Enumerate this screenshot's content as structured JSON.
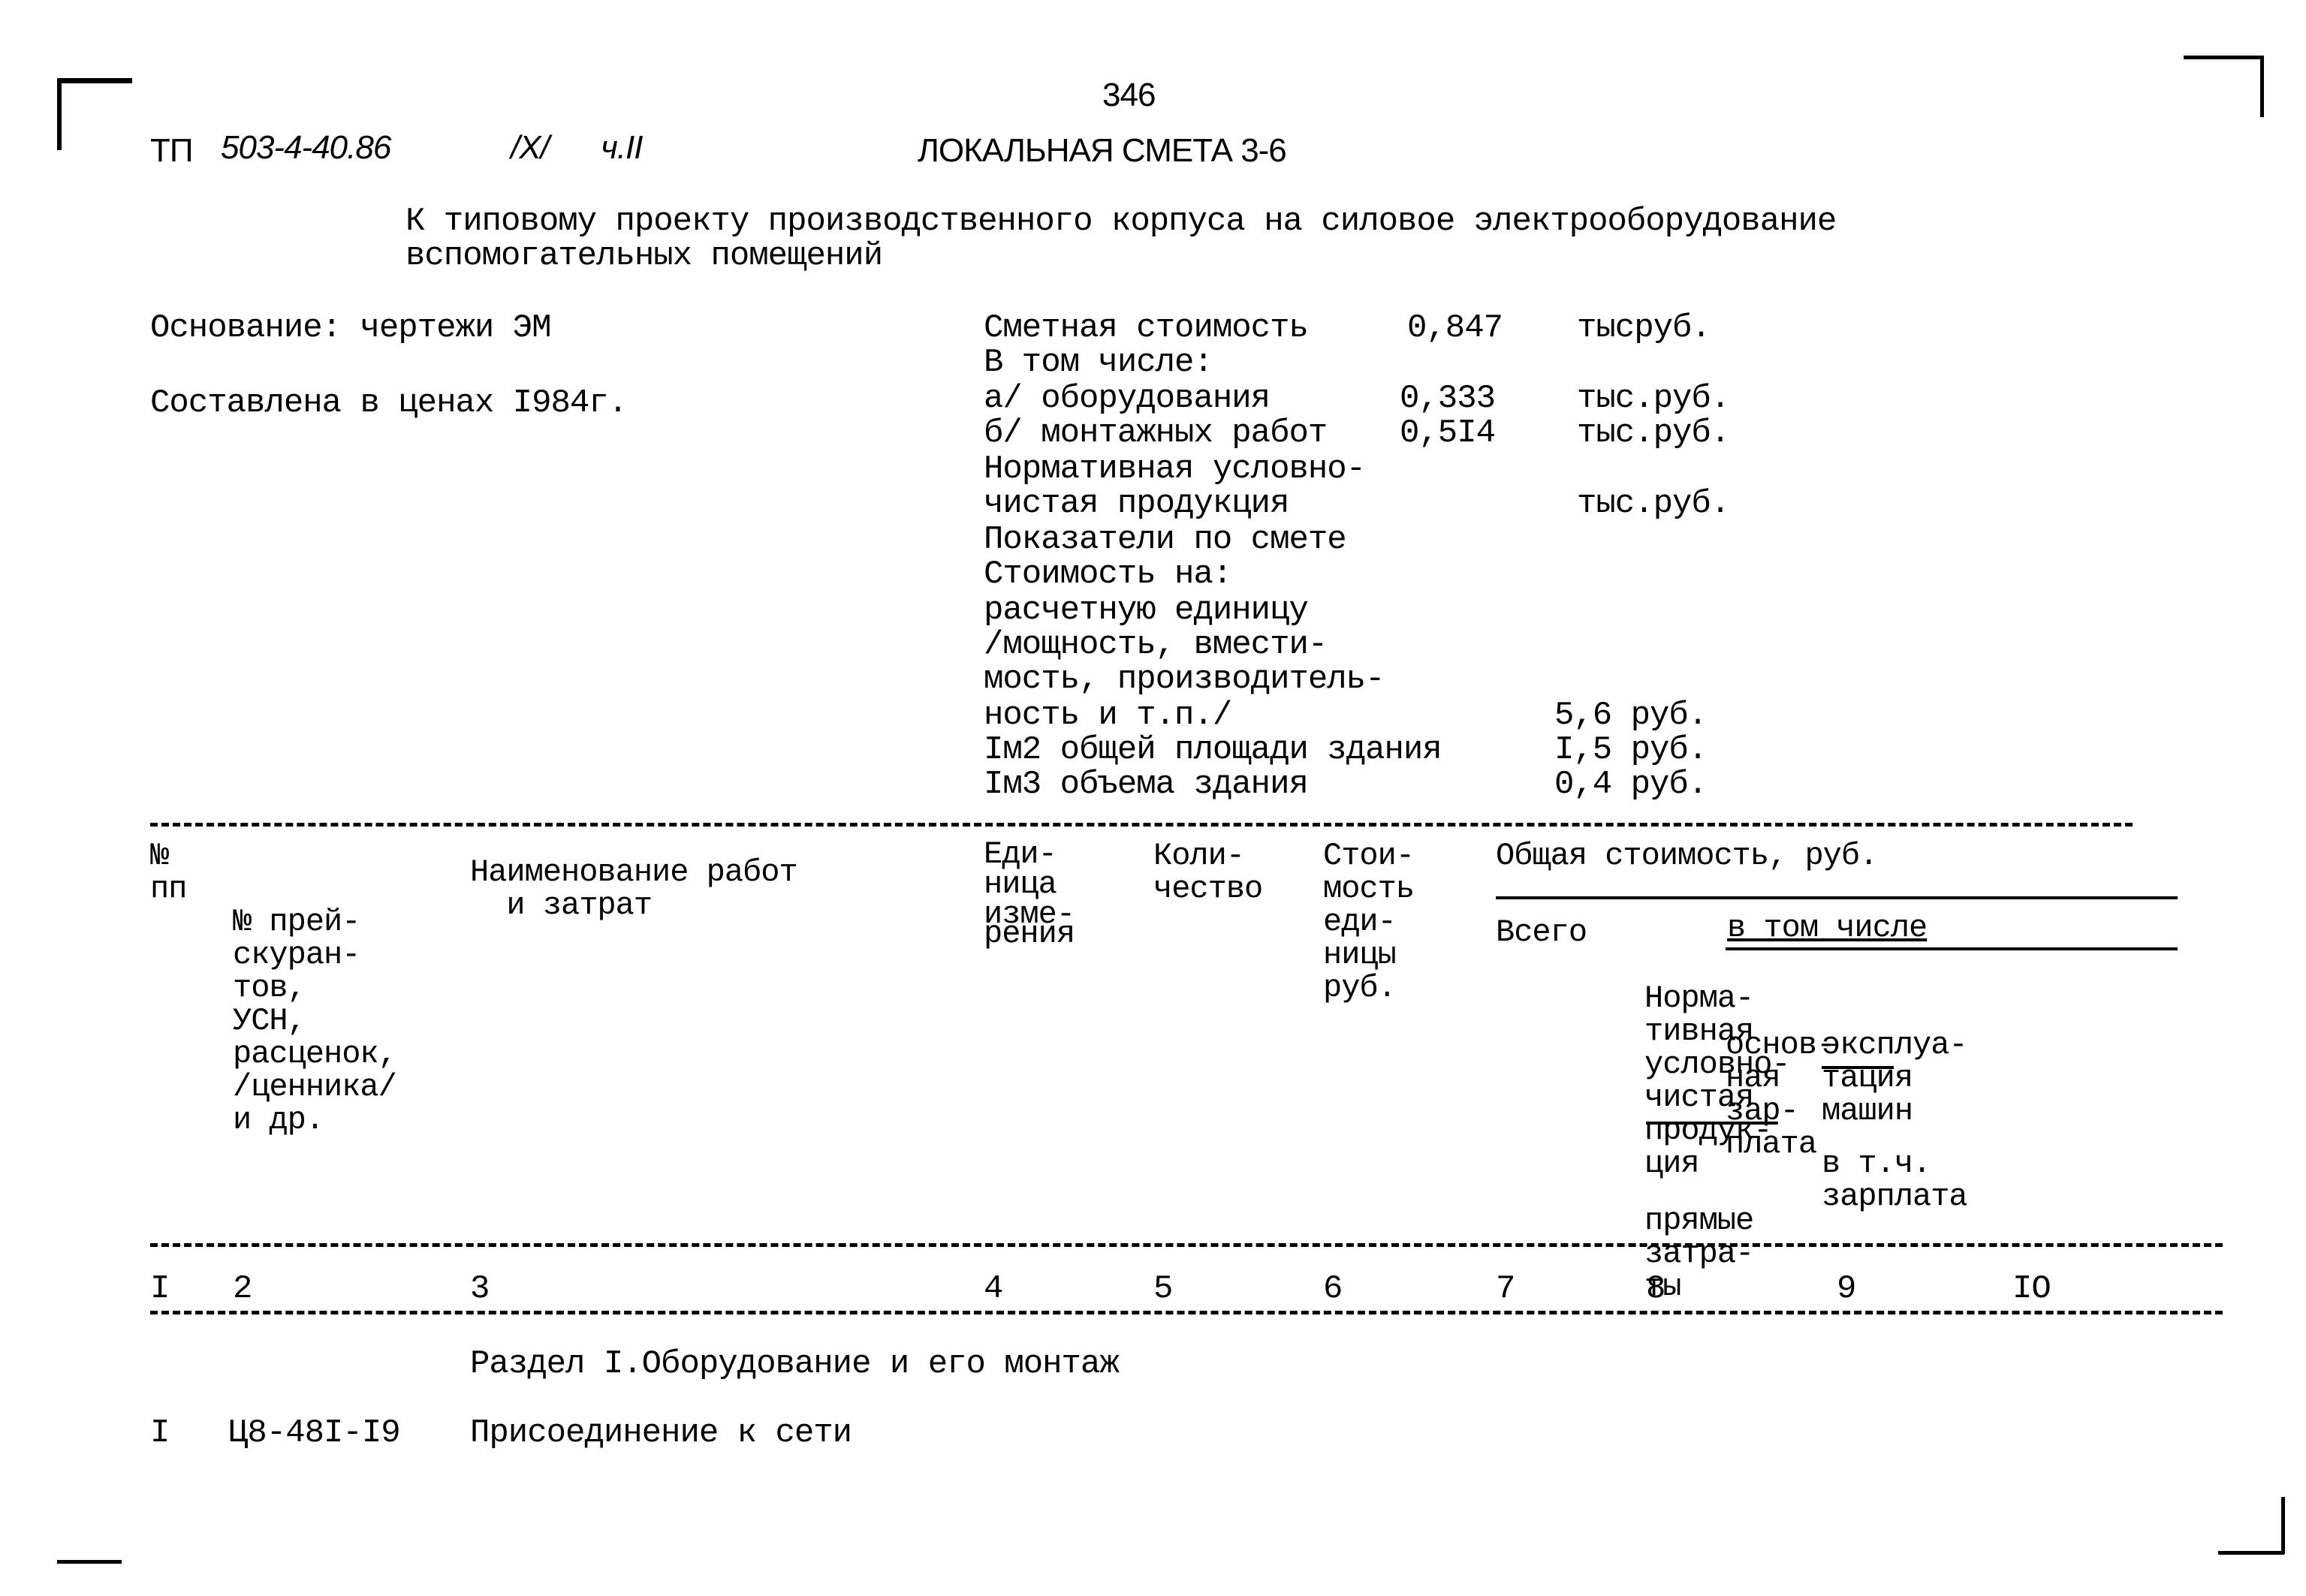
{
  "page_number": "346",
  "doc_code": {
    "prefix": "ТП",
    "code": "503-4-40.86",
    "volume": "/X/",
    "part": "ч.II"
  },
  "title": "ЛОКАЛЬНАЯ СМЕТА 3-6",
  "subtitle": [
    "К типовому проекту производственного корпуса на силовое электрооборудование",
    "вспомогательных помещений"
  ],
  "basis": "Основание: чертежи ЭМ",
  "prices": "Составлена в ценах I984г.",
  "summary": {
    "estimated_cost_label": "Сметная стоимость",
    "estimated_cost_value": "0,847",
    "estimated_cost_unit": "тысруб.",
    "including_label": "В том числе:",
    "equipment_label": "а/ оборудования",
    "equipment_value": "0,333",
    "equipment_unit": "тыс.руб.",
    "installation_label": "б/ монтажных работ",
    "installation_value": "0,5I4",
    "installation_unit": "тыс.руб.",
    "normative_label_1": "Нормативная условно-",
    "normative_label_2": "чистая продукция",
    "normative_unit": "тыс.руб.",
    "indicators_label": "Показатели по смете",
    "cost_per_label": "Стоимость на:",
    "unit_label_1": "расчетную единицу",
    "unit_label_2": "/мощность, вмести-",
    "unit_label_3": "мость, производитель-",
    "unit_label_4": "ность и т.п./",
    "unit_value": "5,6 руб.",
    "area_label": "Iм2 общей площади здания",
    "area_value": "I,5 руб.",
    "volume_label": "Iм3 объема здания",
    "volume_value": "0,4 руб."
  },
  "table": {
    "headers": {
      "col1": [
        "№",
        "пп"
      ],
      "col2": [
        "№ прей-",
        "скуран-",
        "тов,",
        "УСН,",
        "расценок,",
        "/ценника/",
        "и др."
      ],
      "col3": [
        "Наименование работ",
        "  и затрат"
      ],
      "col4": [
        "Еди-",
        "ница",
        "изме-",
        "рения"
      ],
      "col5": [
        "Коли-",
        "чество"
      ],
      "col6": [
        "Стои-",
        "мость",
        "еди-",
        "ницы",
        "руб."
      ],
      "total_group": "Общая стоимость, руб.",
      "col7": "Всего",
      "col8_top": [
        "Норма-",
        "тивная",
        "условно-",
        "чистая",
        "продук-",
        "ция"
      ],
      "col8_bottom": [
        "прямые",
        "затра-",
        "ты"
      ],
      "incl_group": "в том числе",
      "col9": [
        "основ-",
        "ная",
        "зар-",
        "плата"
      ],
      "col10_top": [
        "эксплуа-",
        "тация",
        "машин"
      ],
      "col10_bottom": [
        "в т.ч.",
        "зарплата"
      ]
    },
    "column_numbers": [
      "I",
      "2",
      "3",
      "4",
      "5",
      "6",
      "7",
      "8",
      "9",
      "IO"
    ],
    "section_title": "Раздел I.Оборудование и его монтаж",
    "rows": [
      {
        "num": "I",
        "code": "Ц8-48I-I9",
        "name": "Присоединение к сети"
      }
    ]
  }
}
